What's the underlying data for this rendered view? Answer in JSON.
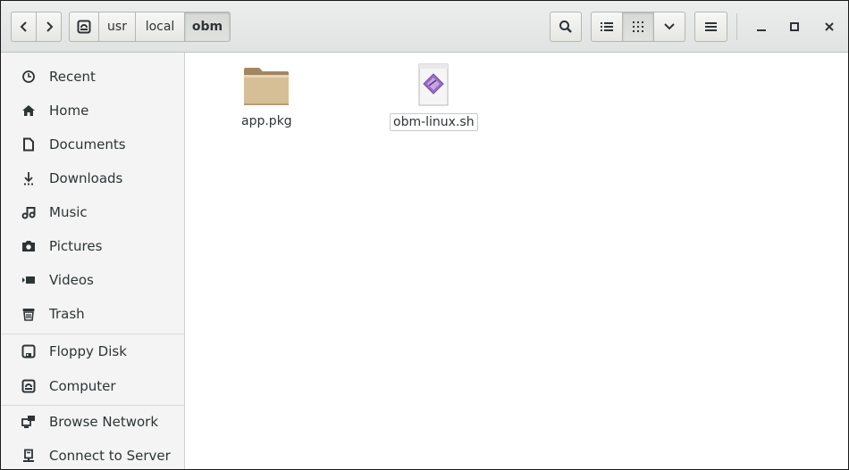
{
  "window": {
    "path": [
      "usr",
      "local",
      "obm"
    ]
  },
  "toolbar": {
    "back_icon": "chevron-left-icon",
    "forward_icon": "chevron-right-icon",
    "root_icon": "drive-icon",
    "search_icon": "search-icon",
    "list_view_icon": "list-view-icon",
    "grid_view_icon": "grid-view-icon",
    "view_options_icon": "chevron-down-icon",
    "menu_icon": "hamburger-icon"
  },
  "sidebar": {
    "items": [
      {
        "label": "Recent",
        "icon": "clock-icon"
      },
      {
        "label": "Home",
        "icon": "home-icon"
      },
      {
        "label": "Documents",
        "icon": "document-icon"
      },
      {
        "label": "Downloads",
        "icon": "download-icon"
      },
      {
        "label": "Music",
        "icon": "music-icon"
      },
      {
        "label": "Pictures",
        "icon": "camera-icon"
      },
      {
        "label": "Videos",
        "icon": "video-icon"
      },
      {
        "label": "Trash",
        "icon": "trash-icon"
      },
      {
        "label": "Floppy Disk",
        "icon": "floppy-icon"
      },
      {
        "label": "Computer",
        "icon": "computer-icon"
      },
      {
        "label": "Browse Network",
        "icon": "network-icon"
      },
      {
        "label": "Connect to Server",
        "icon": "server-icon"
      }
    ]
  },
  "files": [
    {
      "name": "app.pkg",
      "icon": "folder-icon"
    },
    {
      "name": "obm-linux.sh",
      "icon": "script-file-icon"
    }
  ],
  "colors": {
    "folder": "#d3b98c",
    "script_accent": "#9a6ec2"
  }
}
